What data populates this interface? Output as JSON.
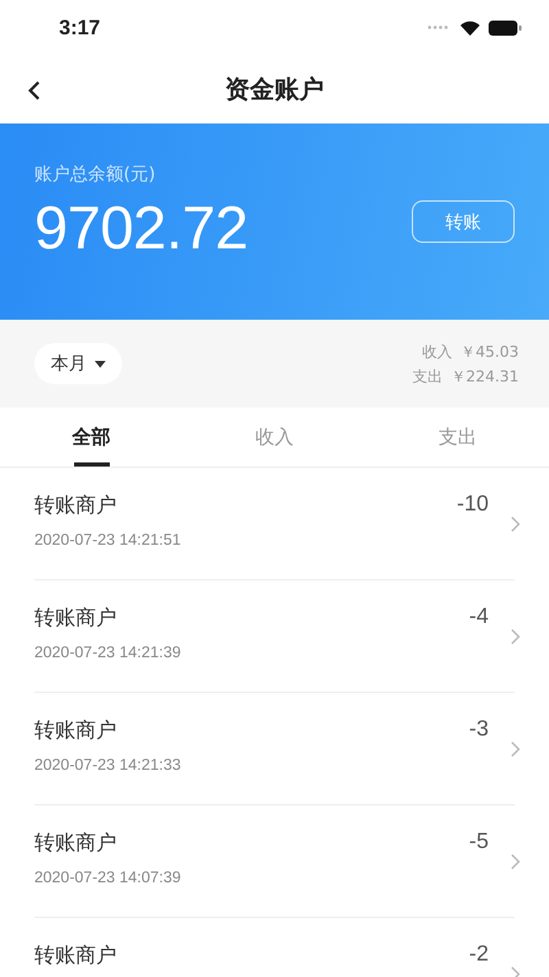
{
  "status_bar": {
    "time": "3:17"
  },
  "nav": {
    "title": "资金账户"
  },
  "balance": {
    "label": "账户总余额(元)",
    "amount": "9702.72",
    "button": "转账"
  },
  "summary": {
    "period": "本月",
    "income_label": "收入",
    "income": "￥45.03",
    "expense_label": "支出",
    "expense": "￥224.31"
  },
  "tabs": [
    {
      "label": "全部",
      "selected": true
    },
    {
      "label": "收入",
      "selected": false
    },
    {
      "label": "支出",
      "selected": false
    }
  ],
  "transactions": [
    {
      "title": "转账商户",
      "time": "2020-07-23 14:21:51",
      "amount": "-10"
    },
    {
      "title": "转账商户",
      "time": "2020-07-23 14:21:39",
      "amount": "-4"
    },
    {
      "title": "转账商户",
      "time": "2020-07-23 14:21:33",
      "amount": "-3"
    },
    {
      "title": "转账商户",
      "time": "2020-07-23 14:07:39",
      "amount": "-5"
    },
    {
      "title": "转账商户",
      "amount": "-2"
    }
  ]
}
